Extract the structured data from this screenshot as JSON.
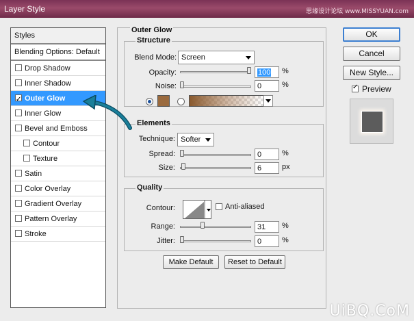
{
  "window": {
    "title": "Layer Style",
    "watermark_top": "思缘设计论坛 www.MISSYUAN.com",
    "watermark_bottom": "UiBQ.CoM"
  },
  "styles_panel": {
    "header": "Styles",
    "blending": "Blending Options: Default",
    "items": [
      {
        "label": "Drop Shadow",
        "checked": false,
        "selected": false,
        "sub": false
      },
      {
        "label": "Inner Shadow",
        "checked": false,
        "selected": false,
        "sub": false
      },
      {
        "label": "Outer Glow",
        "checked": true,
        "selected": true,
        "sub": false
      },
      {
        "label": "Inner Glow",
        "checked": false,
        "selected": false,
        "sub": false
      },
      {
        "label": "Bevel and Emboss",
        "checked": false,
        "selected": false,
        "sub": false
      },
      {
        "label": "Contour",
        "checked": false,
        "selected": false,
        "sub": true
      },
      {
        "label": "Texture",
        "checked": false,
        "selected": false,
        "sub": true
      },
      {
        "label": "Satin",
        "checked": false,
        "selected": false,
        "sub": false
      },
      {
        "label": "Color Overlay",
        "checked": false,
        "selected": false,
        "sub": false
      },
      {
        "label": "Gradient Overlay",
        "checked": false,
        "selected": false,
        "sub": false
      },
      {
        "label": "Pattern Overlay",
        "checked": false,
        "selected": false,
        "sub": false
      },
      {
        "label": "Stroke",
        "checked": false,
        "selected": false,
        "sub": false
      }
    ]
  },
  "outer_glow": {
    "title": "Outer Glow",
    "structure": {
      "title": "Structure",
      "blend_mode_label": "Blend Mode:",
      "blend_mode_value": "Screen",
      "opacity_label": "Opacity:",
      "opacity_value": "100",
      "opacity_unit": "%",
      "opacity_fraction": 1.0,
      "noise_label": "Noise:",
      "noise_value": "0",
      "noise_unit": "%",
      "noise_fraction": 0.0,
      "color": "#9a6a3e",
      "gradient_from": "#8a5a2e",
      "color_mode": "solid"
    },
    "elements": {
      "title": "Elements",
      "technique_label": "Technique:",
      "technique_value": "Softer",
      "spread_label": "Spread:",
      "spread_value": "0",
      "spread_unit": "%",
      "spread_fraction": 0.0,
      "size_label": "Size:",
      "size_value": "6",
      "size_unit": "px",
      "size_fraction": 0.024
    },
    "quality": {
      "title": "Quality",
      "contour_label": "Contour:",
      "anti_aliased_label": "Anti-aliased",
      "anti_aliased": false,
      "range_label": "Range:",
      "range_value": "31",
      "range_unit": "%",
      "range_fraction": 0.31,
      "jitter_label": "Jitter:",
      "jitter_value": "0",
      "jitter_unit": "%",
      "jitter_fraction": 0.0
    },
    "make_default": "Make Default",
    "reset_default": "Reset to Default"
  },
  "buttons": {
    "ok": "OK",
    "cancel": "Cancel",
    "new_style": "New Style...",
    "preview_label": "Preview",
    "preview_checked": true
  },
  "colors": {
    "selection": "#3399ff",
    "annotation_arrow": "#1a7f9a"
  }
}
